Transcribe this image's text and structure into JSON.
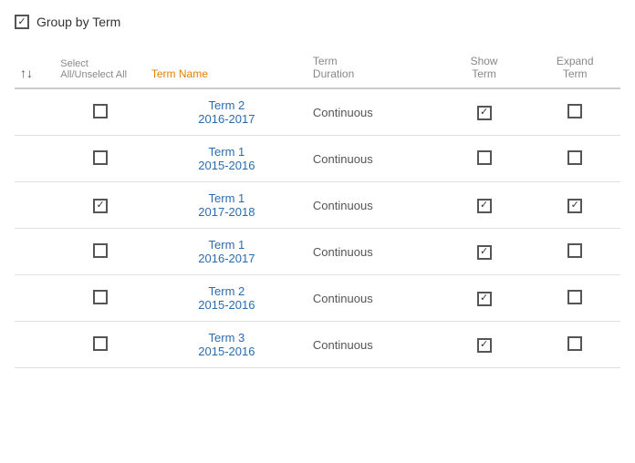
{
  "groupBy": {
    "label": "Group by Term",
    "checked": true
  },
  "table": {
    "headers": {
      "sort": "",
      "selectAll": "Select All/Unselect All",
      "termName": "Term Name",
      "termDuration": "Term Duration",
      "showTerm": "Show Term",
      "expandTerm": "Expand Term"
    },
    "rows": [
      {
        "select": false,
        "termName": "Term 2\n2016-2017",
        "duration": "Continuous",
        "showTerm": true,
        "expandTerm": false
      },
      {
        "select": false,
        "termName": "Term 1\n2015-2016",
        "duration": "Continuous",
        "showTerm": false,
        "expandTerm": false
      },
      {
        "select": true,
        "termName": "Term 1\n2017-2018",
        "duration": "Continuous",
        "showTerm": true,
        "expandTerm": true
      },
      {
        "select": false,
        "termName": "Term 1\n2016-2017",
        "duration": "Continuous",
        "showTerm": true,
        "expandTerm": false
      },
      {
        "select": false,
        "termName": "Term 2\n2015-2016",
        "duration": "Continuous",
        "showTerm": true,
        "expandTerm": false
      },
      {
        "select": false,
        "termName": "Term 3\n2015-2016",
        "duration": "Continuous",
        "showTerm": true,
        "expandTerm": false
      }
    ]
  }
}
